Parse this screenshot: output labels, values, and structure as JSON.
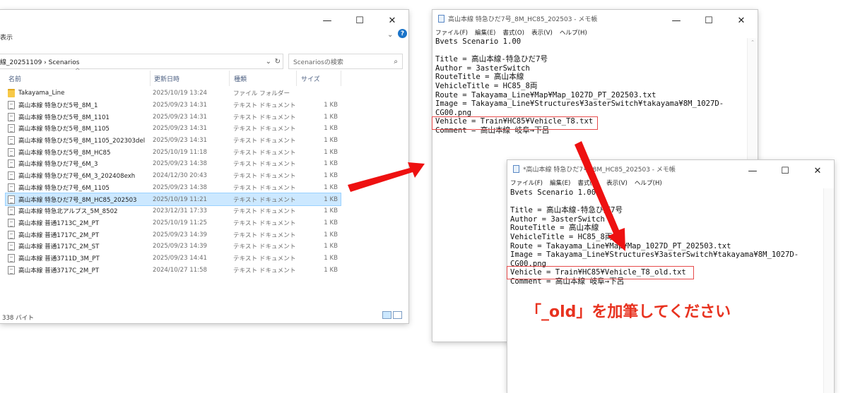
{
  "explorer": {
    "menu_fragment": "表示",
    "address_path": "線_20251109 › Scenarios",
    "search_placeholder": "Scenariosの検索",
    "columns": [
      "名前",
      "更新日時",
      "種類",
      "サイズ"
    ],
    "rows": [
      {
        "name": "Takayama_Line",
        "date": "2025/10/19 13:24",
        "type": "ファイル フォルダー",
        "size": "",
        "kind": "folder",
        "selected": false
      },
      {
        "name": "高山本線 特急ひだ5号_8M_1",
        "date": "2025/09/23 14:31",
        "type": "テキスト ドキュメント",
        "size": "1 KB",
        "kind": "file",
        "selected": false
      },
      {
        "name": "高山本線 特急ひだ5号_8M_1101",
        "date": "2025/09/23 14:31",
        "type": "テキスト ドキュメント",
        "size": "1 KB",
        "kind": "file",
        "selected": false
      },
      {
        "name": "高山本線 特急ひだ5号_8M_1105",
        "date": "2025/09/23 14:31",
        "type": "テキスト ドキュメント",
        "size": "1 KB",
        "kind": "file",
        "selected": false
      },
      {
        "name": "高山本線 特急ひだ5号_8M_1105_202303del",
        "date": "2025/09/23 14:31",
        "type": "テキスト ドキュメント",
        "size": "1 KB",
        "kind": "file",
        "selected": false
      },
      {
        "name": "高山本線 特急ひだ5号_8M_HC85",
        "date": "2025/10/19 11:18",
        "type": "テキスト ドキュメント",
        "size": "1 KB",
        "kind": "file",
        "selected": false
      },
      {
        "name": "高山本線 特急ひだ7号_6M_3",
        "date": "2025/09/23 14:38",
        "type": "テキスト ドキュメント",
        "size": "1 KB",
        "kind": "file",
        "selected": false
      },
      {
        "name": "高山本線 特急ひだ7号_6M_3_202408exh",
        "date": "2024/12/30 20:43",
        "type": "テキスト ドキュメント",
        "size": "1 KB",
        "kind": "file",
        "selected": false
      },
      {
        "name": "高山本線 特急ひだ7号_6M_1105",
        "date": "2025/09/23 14:38",
        "type": "テキスト ドキュメント",
        "size": "1 KB",
        "kind": "file",
        "selected": false
      },
      {
        "name": "高山本線 特急ひだ7号_8M_HC85_202503",
        "date": "2025/10/19 11:21",
        "type": "テキスト ドキュメント",
        "size": "1 KB",
        "kind": "file",
        "selected": true
      },
      {
        "name": "高山本線 特急北アルプス_5M_8502",
        "date": "2023/12/31 17:33",
        "type": "テキスト ドキュメント",
        "size": "1 KB",
        "kind": "file",
        "selected": false
      },
      {
        "name": "高山本線 普通1713C_2M_PT",
        "date": "2025/10/19 11:25",
        "type": "テキスト ドキュメント",
        "size": "1 KB",
        "kind": "file",
        "selected": false
      },
      {
        "name": "高山本線 普通1717C_2M_PT",
        "date": "2025/09/23 14:39",
        "type": "テキスト ドキュメント",
        "size": "1 KB",
        "kind": "file",
        "selected": false
      },
      {
        "name": "高山本線 普通1717C_2M_ST",
        "date": "2025/09/23 14:39",
        "type": "テキスト ドキュメント",
        "size": "1 KB",
        "kind": "file",
        "selected": false
      },
      {
        "name": "高山本線 普通3711D_3M_PT",
        "date": "2025/09/23 14:41",
        "type": "テキスト ドキュメント",
        "size": "1 KB",
        "kind": "file",
        "selected": false
      },
      {
        "name": "高山本線 普通3717C_2M_PT",
        "date": "2024/10/27 11:58",
        "type": "テキスト ドキュメント",
        "size": "1 KB",
        "kind": "file",
        "selected": false
      }
    ],
    "status_text": "338 バイト"
  },
  "notepad1": {
    "title": "高山本線 特急ひだ7号_8M_HC85_202503 - メモ帳",
    "menu": [
      "ファイル(F)",
      "編集(E)",
      "書式(O)",
      "表示(V)",
      "ヘルプ(H)"
    ],
    "content": "Bvets Scenario 1.00\n\nTitle = 高山本線-特急ひだ7号\nAuthor = 3asterSwitch\nRouteTitle = 高山本線\nVehicleTitle = HC85_8両\nRoute = Takayama_Line¥Map¥Map_1027D_PT_202503.txt\nImage = Takayama_Line¥Structures¥3asterSwitch¥takayama¥8M_1027D-\nCG00.png\nVehicle = Train¥HC85¥Vehicle_T8.txt\nComment = 高山本線 岐阜→下呂"
  },
  "notepad2": {
    "title": "*高山本線 特急ひだ7号_8M_HC85_202503 - メモ帳",
    "menu": [
      "ファイル(F)",
      "編集(E)",
      "書式(O)",
      "表示(V)",
      "ヘルプ(H)"
    ],
    "content": "Bvets Scenario 1.00\n\nTitle = 高山本線-特急ひだ7号\nAuthor = 3asterSwitch\nRouteTitle = 高山本線\nVehicleTitle = HC85_8両\nRoute = Takayama_Line¥Map¥Map_1027D_PT_202503.txt\nImage = Takayama_Line¥Structures¥3asterSwitch¥takayama¥8M_1027D-\nCG00.png\nVehicle = Train¥HC85¥Vehicle_T8_old.txt\nComment = 高山本線 岐阜→下呂"
  },
  "window_controls": {
    "minimize": "—",
    "maximize": "☐",
    "close": "✕"
  },
  "annotation_text": "「_old」を加筆してください",
  "colors": {
    "highlight": "#e74c4c",
    "arrow": "#ee1111",
    "note": "#e8321f",
    "selection": "#cce8ff"
  }
}
